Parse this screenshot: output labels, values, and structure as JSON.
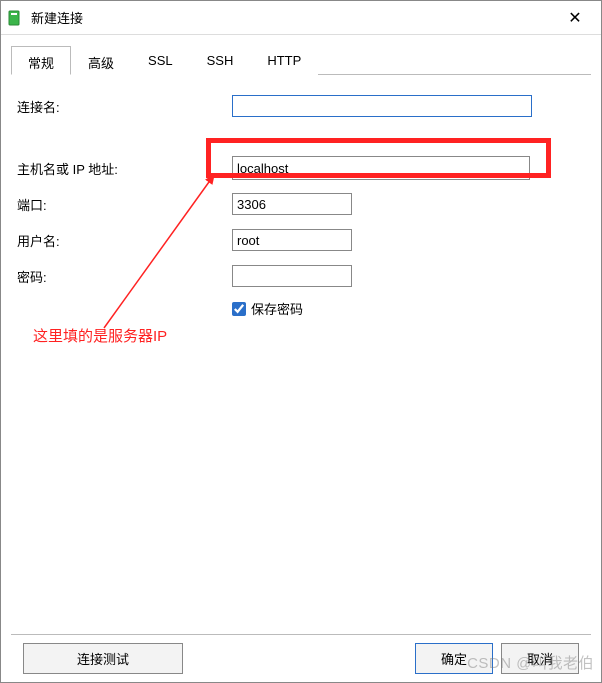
{
  "window": {
    "title": "新建连接"
  },
  "tabs": {
    "items": [
      {
        "label": "常规",
        "active": true
      },
      {
        "label": "高级"
      },
      {
        "label": "SSL"
      },
      {
        "label": "SSH"
      },
      {
        "label": "HTTP"
      }
    ]
  },
  "form": {
    "conn_name": {
      "label": "连接名:",
      "value": ""
    },
    "host": {
      "label": "主机名或 IP 地址:",
      "value": "localhost"
    },
    "port": {
      "label": "端口:",
      "value": "3306"
    },
    "user": {
      "label": "用户名:",
      "value": "root"
    },
    "password": {
      "label": "密码:",
      "value": ""
    },
    "save_password": {
      "label": "保存密码",
      "checked": true
    }
  },
  "annotation": {
    "text": "这里填的是服务器IP"
  },
  "buttons": {
    "test": "连接测试",
    "ok": "确定",
    "cancel": "取消"
  },
  "watermark": "CSDN @叫我老伯"
}
